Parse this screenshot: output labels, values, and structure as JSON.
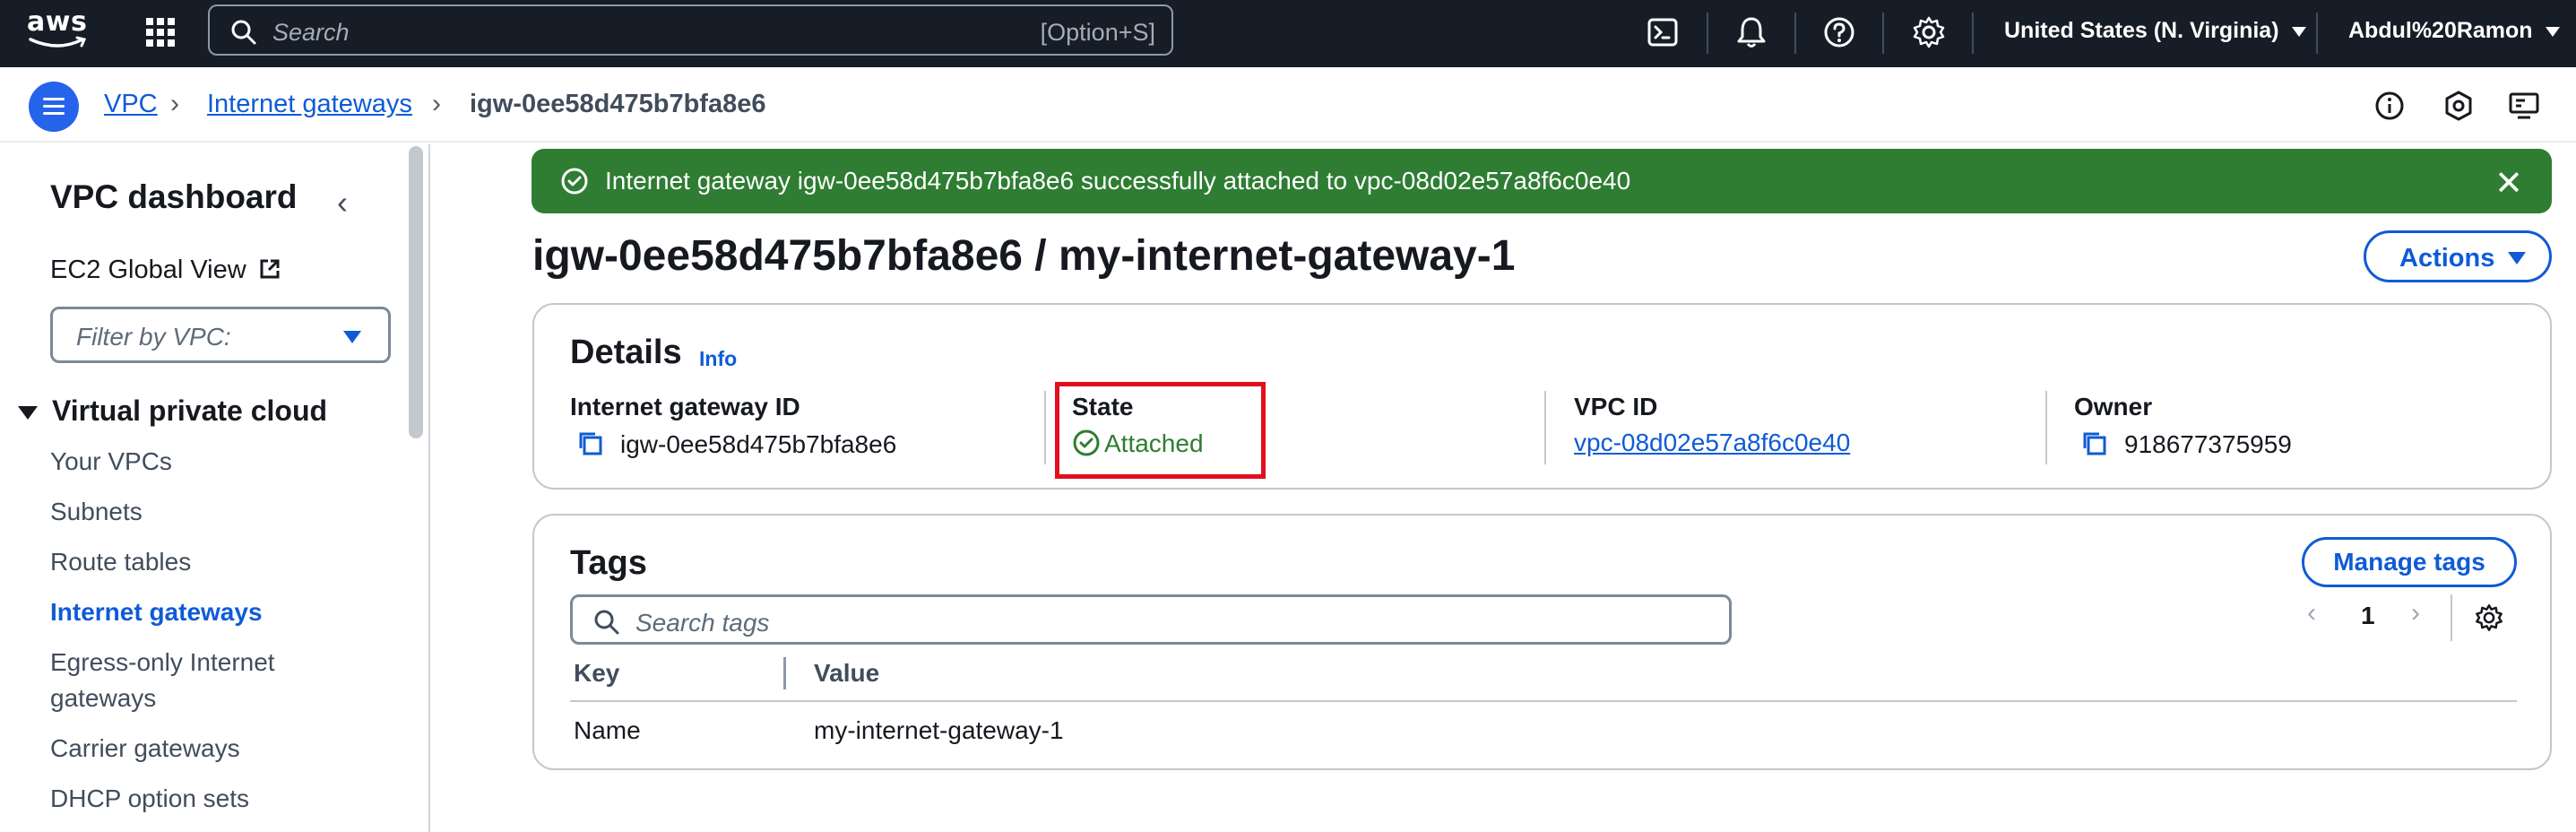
{
  "topnav": {
    "logo": "aws",
    "search_placeholder": "Search",
    "search_shortcut": "[Option+S]",
    "icons": [
      "grid-icon",
      "cloudshell-icon",
      "bell-icon",
      "help-icon",
      "gear-icon"
    ],
    "region": "United States (N. Virginia)",
    "user": "Abdul%20Ramon"
  },
  "breadcrumb": {
    "items": [
      "VPC",
      "Internet gateways"
    ],
    "current": "igw-0ee58d475b7bfa8e6",
    "util_icons": [
      "info-icon",
      "feedback-icon",
      "display-icon"
    ]
  },
  "sidebar": {
    "title": "VPC dashboard",
    "ec2_global_view": "EC2 Global View",
    "filter_placeholder": "Filter by VPC:",
    "section": "Virtual private cloud",
    "items": [
      {
        "label": "Your VPCs",
        "active": false
      },
      {
        "label": "Subnets",
        "active": false
      },
      {
        "label": "Route tables",
        "active": false
      },
      {
        "label": "Internet gateways",
        "active": true
      },
      {
        "label": "Egress-only Internet gateways",
        "active": false
      },
      {
        "label": "Carrier gateways",
        "active": false
      },
      {
        "label": "DHCP option sets",
        "active": false
      }
    ]
  },
  "flash": {
    "message": "Internet gateway igw-0ee58d475b7bfa8e6 successfully attached to vpc-08d02e57a8f6c0e40",
    "type": "success",
    "color": "#2e7d32"
  },
  "page": {
    "title": "igw-0ee58d475b7bfa8e6 / my-internet-gateway-1",
    "actions_label": "Actions"
  },
  "details": {
    "title": "Details",
    "info_label": "Info",
    "fields": [
      {
        "label": "Internet gateway ID",
        "value": "igw-0ee58d475b7bfa8e6"
      },
      {
        "label": "State",
        "value": "Attached"
      },
      {
        "label": "VPC ID",
        "value": "vpc-08d02e57a8f6c0e40"
      },
      {
        "label": "Owner",
        "value": "918677375959"
      }
    ]
  },
  "tags": {
    "title": "Tags",
    "manage_label": "Manage tags",
    "search_placeholder": "Search tags",
    "page": "1",
    "columns": [
      "Key",
      "Value"
    ],
    "rows": [
      {
        "key": "Name",
        "value": "my-internet-gateway-1"
      }
    ]
  },
  "colors": {
    "nav_bg": "#161d26",
    "link": "#0f5bd6",
    "success": "#2e7d32",
    "highlight": "#e0101f"
  }
}
